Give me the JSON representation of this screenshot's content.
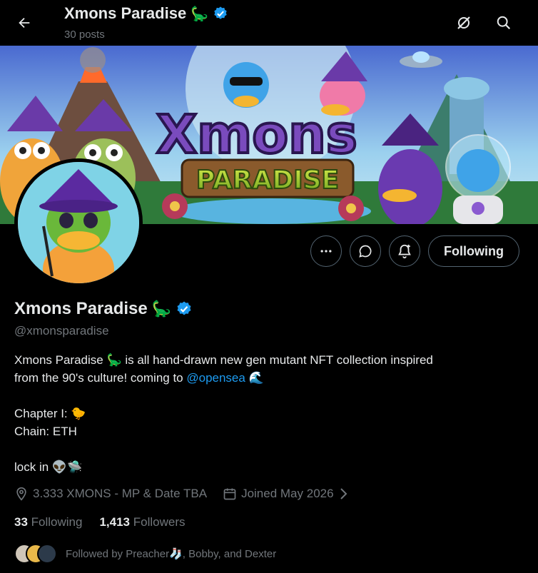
{
  "header": {
    "title": "Xmons Paradise",
    "title_emoji": "🦕",
    "posts": "30 posts",
    "back_icon": "arrow-left-icon",
    "grok_icon": "grok-icon",
    "search_icon": "search-icon"
  },
  "banner": {
    "logo_line1": "Xmons",
    "logo_line2": "PARADISE"
  },
  "actions": {
    "more_icon": "more-icon",
    "message_icon": "message-icon",
    "notify_icon": "bell-plus-icon",
    "follow_label": "Following"
  },
  "profile": {
    "name": "Xmons Paradise",
    "name_emoji": "🦕",
    "handle": "@xmonsparadise",
    "bio": {
      "line1_a": "Xmons Paradise ",
      "line1_emoji": "🦕",
      "line1_b": " is all hand-drawn new gen mutant NFT collection inspired",
      "line2_a": "from the 90's culture! coming to ",
      "line2_mention": "@opensea",
      "line2_emoji": " 🌊",
      "line3": "Chapter I: 🐤",
      "line4": "Chain: ETH",
      "line5": "lock in 👽🛸"
    },
    "location": "3.333 XMONS - MP & Date TBA",
    "joined": "Joined May 2026",
    "following_count": "33",
    "following_label": "Following",
    "followers_count": "1,413",
    "followers_label": "Followers",
    "followed_by": "Followed by Preacher",
    "followed_by_emoji": "🧦",
    "followed_by_rest": ", Bobby, and Dexter"
  },
  "colors": {
    "accent": "#1d9bf0",
    "muted": "#71767b",
    "text": "#e7e9ea",
    "border": "#536471"
  }
}
